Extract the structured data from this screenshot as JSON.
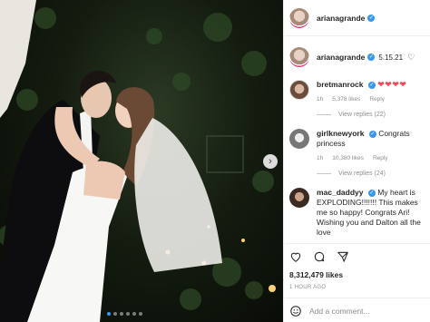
{
  "post": {
    "author": "arianagrande",
    "photo_description": "",
    "carousel": {
      "total": 6,
      "active": 0
    }
  },
  "caption": {
    "username": "arianagrande",
    "date": "5.15.21"
  },
  "comments": [
    {
      "username": "bretmanrock",
      "text": "❤❤❤❤",
      "time": "1h",
      "likes": "5,378 likes",
      "reply": "Reply",
      "replies": "View replies (22)"
    },
    {
      "username": "girlknewyork",
      "text": "Congrats princess",
      "time": "1h",
      "likes": "10,380 likes",
      "reply": "Reply",
      "replies": "View replies (24)"
    },
    {
      "username": "mac_daddyy",
      "text": "My heart is EXPLODING!!!!!!! This makes me so happy! Congrats Ari! Wishing you and Dalton all the love"
    }
  ],
  "actions": {
    "likes": "8,312,479 likes",
    "time_ago": "1 HOUR AGO"
  },
  "add_comment": {
    "placeholder": "Add a comment..."
  },
  "icons": [
    "heart-icon",
    "comment-icon",
    "share-icon",
    "next-arrow-icon",
    "smiley-icon",
    "verified-icon"
  ],
  "colors": {
    "accent": "#3897f0",
    "heart": "#ed4956",
    "text": "#262626",
    "muted": "#8e8e8e"
  }
}
